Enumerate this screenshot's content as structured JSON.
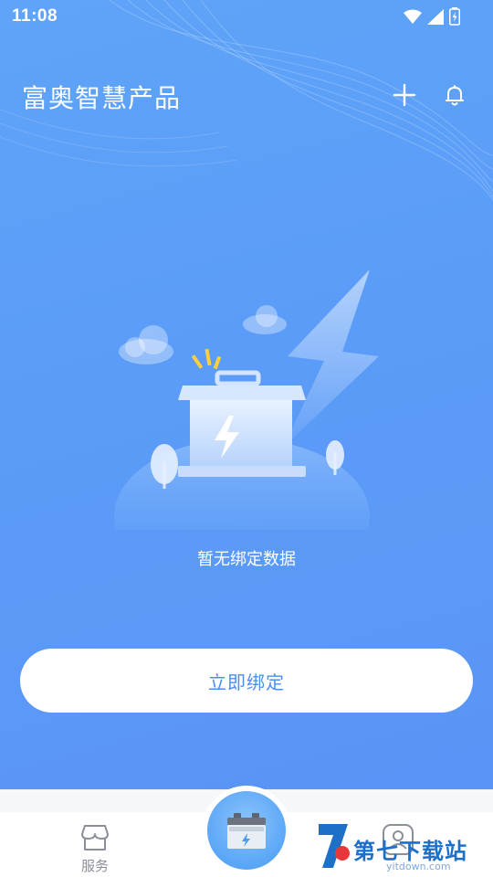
{
  "status_bar": {
    "time": "11:08"
  },
  "header": {
    "title": "富奥智慧产品"
  },
  "empty_state": {
    "message": "暂无绑定数据"
  },
  "bind_button": {
    "label": "立即绑定"
  },
  "bottom_nav": {
    "items": [
      {
        "label": "服务",
        "icon": "service-store-icon"
      },
      {
        "label": "",
        "icon": "battery-icon"
      },
      {
        "label": "",
        "icon": "user-profile-icon"
      }
    ]
  },
  "watermark": {
    "text": "第七下载站",
    "url": "yitdown.com"
  },
  "colors": {
    "background_top": "#5fa4f8",
    "background_bottom": "#5a92f5",
    "button_text": "#4b8ef3",
    "nav_label": "#8a8f99"
  }
}
